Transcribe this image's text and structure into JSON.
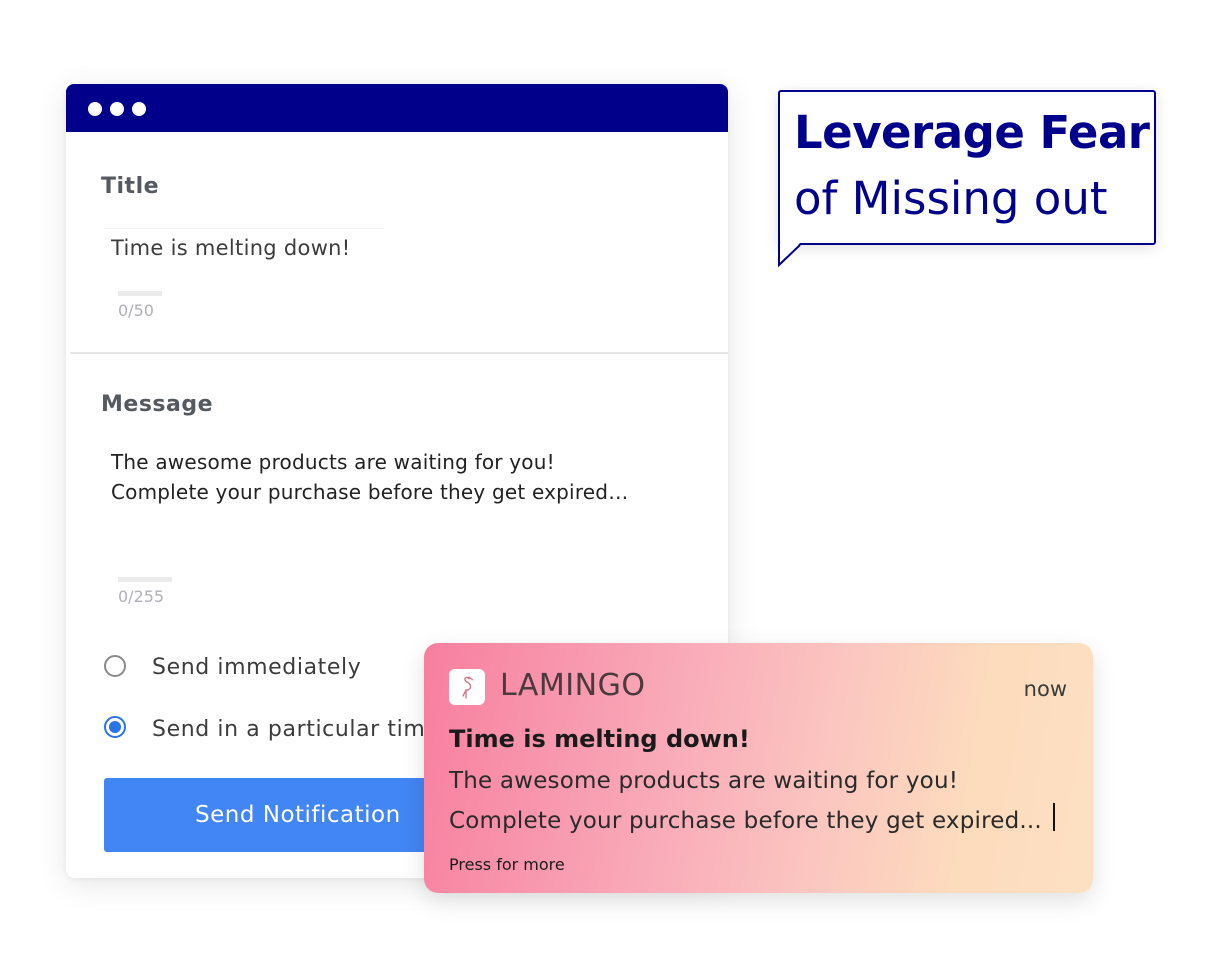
{
  "form": {
    "title_label": "Title",
    "title_value": "Time is melting down!",
    "title_counter": "0/50",
    "message_label": "Message",
    "message_lines": [
      "The awesome products are waiting for you!",
      "Complete your purchase before they get expired…"
    ],
    "message_counter": "0/255",
    "schedule_options": [
      {
        "label": "Send immediately",
        "selected": false
      },
      {
        "label": "Send in a particular time",
        "selected": true
      }
    ],
    "send_button_label": "Send Notification"
  },
  "callout": {
    "line1": "Leverage Fear",
    "line2": "of Missing out"
  },
  "notification": {
    "app_icon": "flamingo-icon",
    "app_name": "LAMINGO",
    "time": "now",
    "title": "Time is melting down!",
    "body_lines": [
      "The awesome products are waiting for you!",
      "Complete your purchase before they get expired..."
    ],
    "footer": "Press for more"
  },
  "colors": {
    "titlebar": "#00008b",
    "button": "#4285f4",
    "radio_selected": "#2b74e8",
    "callout_text": "#00008b"
  }
}
